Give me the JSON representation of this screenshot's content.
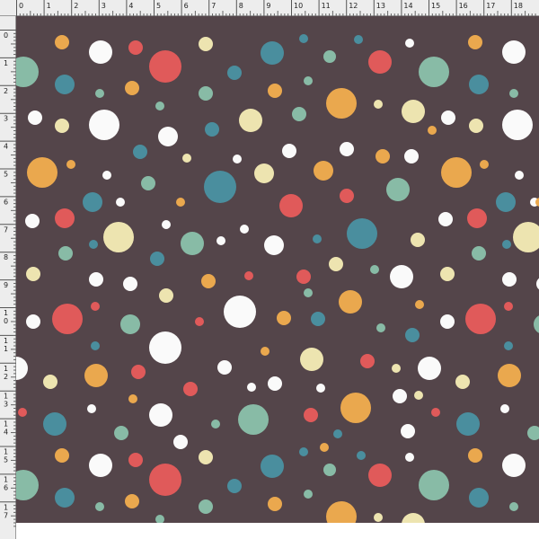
{
  "colors": {
    "background": "#54454a",
    "red": "#e05a5a",
    "orange": "#eaa84e",
    "teal": "#4a8e9e",
    "sage": "#88bba6",
    "cream": "#ede4b0",
    "white": "#fafafa"
  },
  "ruler": {
    "top_labels": [
      "0",
      "1",
      "2",
      "3",
      "4",
      "5",
      "6",
      "7",
      "8",
      "9",
      "10",
      "11",
      "12",
      "13",
      "14",
      "15",
      "16",
      "17",
      "18"
    ],
    "left_labels": [
      "0",
      "1",
      "2",
      "3",
      "4",
      "5",
      "6",
      "7",
      "8",
      "9",
      "1 0",
      "1 1",
      "1 2",
      "1 3",
      "1 4",
      "1 5",
      "1 6",
      "1 7"
    ]
  },
  "pattern": {
    "name": "polka-dot-pattern"
  }
}
